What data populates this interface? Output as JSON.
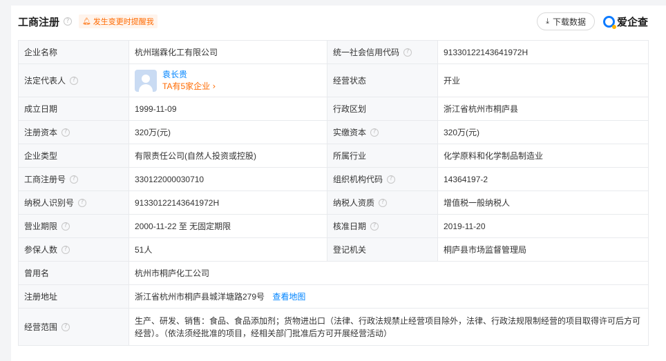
{
  "header": {
    "title": "工商注册",
    "notify_label": "发生变更时提醒我",
    "download_label": "下载数据",
    "brand": "爱企查"
  },
  "rows": {
    "company_name": {
      "label": "企业名称",
      "value": "杭州瑞霖化工有限公司"
    },
    "credit_code": {
      "label": "统一社会信用代码",
      "value": "91330122143641972H"
    },
    "legal_rep": {
      "label": "法定代表人",
      "name": "袁长贵",
      "sub": "TA有5家企业"
    },
    "status": {
      "label": "经营状态",
      "value": "开业"
    },
    "found_date": {
      "label": "成立日期",
      "value": "1999-11-09"
    },
    "region": {
      "label": "行政区划",
      "value": "浙江省杭州市桐庐县"
    },
    "reg_capital": {
      "label": "注册资本",
      "value": "320万(元)"
    },
    "paid_capital": {
      "label": "实缴资本",
      "value": "320万(元)"
    },
    "company_type": {
      "label": "企业类型",
      "value": "有限责任公司(自然人投资或控股)"
    },
    "industry": {
      "label": "所属行业",
      "value": "化学原料和化学制品制造业"
    },
    "reg_number": {
      "label": "工商注册号",
      "value": "330122000030710"
    },
    "org_code": {
      "label": "组织机构代码",
      "value": "14364197-2"
    },
    "taxpayer_id": {
      "label": "纳税人识别号",
      "value": "91330122143641972H"
    },
    "taxpayer_qual": {
      "label": "纳税人资质",
      "value": "增值税一般纳税人"
    },
    "biz_term": {
      "label": "营业期限",
      "value": "2000-11-22 至 无固定期限"
    },
    "approval_date": {
      "label": "核准日期",
      "value": "2019-11-20"
    },
    "insured": {
      "label": "参保人数",
      "value": "51人"
    },
    "authority": {
      "label": "登记机关",
      "value": "桐庐县市场监督管理局"
    },
    "former_name": {
      "label": "曾用名",
      "value": "杭州市桐庐化工公司"
    },
    "address": {
      "label": "注册地址",
      "value": "浙江省杭州市桐庐县城洋塘路279号",
      "map_link": "查看地图"
    },
    "scope": {
      "label": "经营范围",
      "value": "生产、研发、销售：食品、食品添加剂；货物进出口（法律、行政法规禁止经营项目除外，法律、行政法规限制经营的项目取得许可后方可经营）。（依法须经批准的项目，经相关部门批准后方可开展经营活动）"
    }
  },
  "icons": {
    "help": "question-circle-icon",
    "bell": "bell-icon",
    "download": "download-icon",
    "chevron": "chevron-right-icon",
    "logo": "brand-logo-icon"
  },
  "colors": {
    "link": "#0084ff",
    "accent": "#ff6a00",
    "label_bg": "#f7f8fa",
    "border": "#e8eaed"
  }
}
